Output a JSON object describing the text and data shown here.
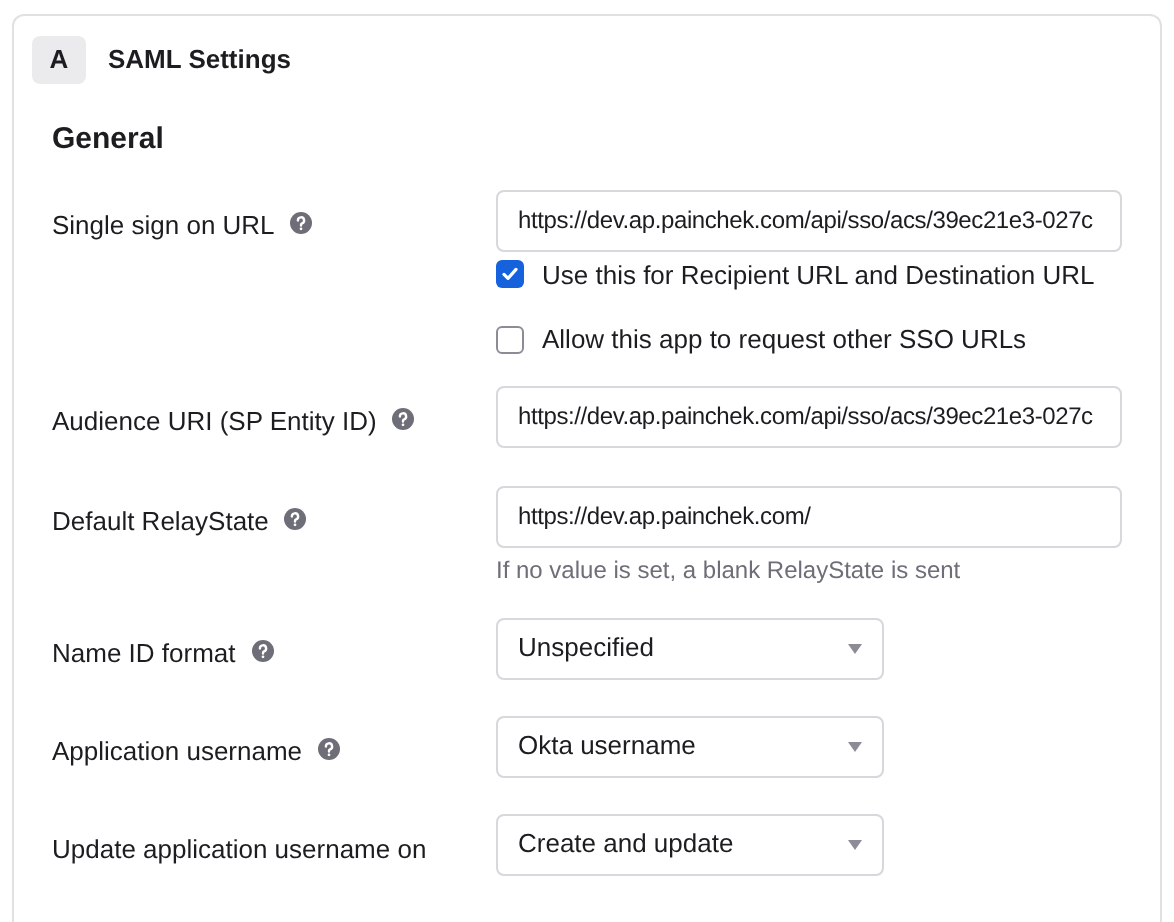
{
  "header": {
    "badge": "A",
    "title": "SAML Settings"
  },
  "section": {
    "title": "General"
  },
  "rows": [
    {
      "label": "Single sign on URL",
      "help": true,
      "kind": "text",
      "value": "https://dev.ap.painchek.com/api/sso/acs/39ec21e3-027c",
      "checkboxes": [
        {
          "label": "Use this for Recipient URL and Destination URL",
          "checked": true
        },
        {
          "label": "Allow this app to request other SSO URLs",
          "checked": false
        }
      ]
    },
    {
      "label": "Audience URI (SP Entity ID)",
      "help": true,
      "kind": "text",
      "value": "https://dev.ap.painchek.com/api/sso/acs/39ec21e3-027c"
    },
    {
      "label": "Default RelayState",
      "help": true,
      "kind": "text",
      "value": "https://dev.ap.painchek.com/",
      "hint": "If no value is set, a blank RelayState is sent"
    },
    {
      "label": "Name ID format",
      "help": true,
      "kind": "select",
      "value": "Unspecified"
    },
    {
      "label": "Application username",
      "help": true,
      "kind": "select",
      "value": "Okta username"
    },
    {
      "label": "Update application username on",
      "help": false,
      "kind": "select",
      "value": "Create and update"
    }
  ]
}
